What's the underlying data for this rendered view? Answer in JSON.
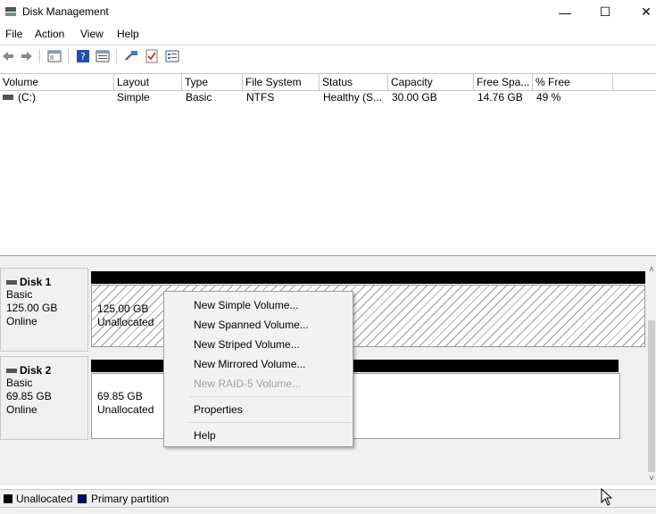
{
  "window": {
    "title": "Disk Management",
    "minimize": "—",
    "maximize": "☐",
    "close": "✕"
  },
  "menu": [
    "File",
    "Action",
    "View",
    "Help"
  ],
  "toolbar": [
    "back-icon",
    "forward-icon",
    "console-tree-icon",
    "help-icon",
    "properties-icon",
    "connect-icon",
    "check-icon",
    "list-icon"
  ],
  "columns": [
    "Volume",
    "Layout",
    "Type",
    "File System",
    "Status",
    "Capacity",
    "Free Spa...",
    "% Free"
  ],
  "volumes": [
    {
      "volume": "(C:)",
      "layout": "Simple",
      "type": "Basic",
      "fs": "NTFS",
      "status": "Healthy (S...",
      "capacity": "30.00 GB",
      "free": "14.76 GB",
      "pct": "49 %"
    }
  ],
  "disks": [
    {
      "name": "Disk 1",
      "type": "Basic",
      "size": "125.00 GB",
      "state": "Online",
      "partition": {
        "size": "125.00 GB",
        "label": "Unallocated"
      }
    },
    {
      "name": "Disk 2",
      "type": "Basic",
      "size": "69.85 GB",
      "state": "Online",
      "partition": {
        "size": "69.85 GB",
        "label": "Unallocated"
      }
    }
  ],
  "legend": [
    {
      "label": "Unallocated",
      "color": "#000000"
    },
    {
      "label": "Primary partition",
      "color": "#000080"
    }
  ],
  "context_menu": {
    "items": [
      {
        "label": "New Simple Volume...",
        "enabled": true
      },
      {
        "label": "New Spanned Volume...",
        "enabled": true
      },
      {
        "label": "New Striped Volume...",
        "enabled": true
      },
      {
        "label": "New Mirrored Volume...",
        "enabled": true
      },
      {
        "label": "New RAID-5 Volume...",
        "enabled": false
      },
      {
        "label": "Properties",
        "enabled": true
      },
      {
        "label": "Help",
        "enabled": true
      }
    ]
  },
  "scroll": {
    "up": "˄",
    "down": "˅"
  }
}
